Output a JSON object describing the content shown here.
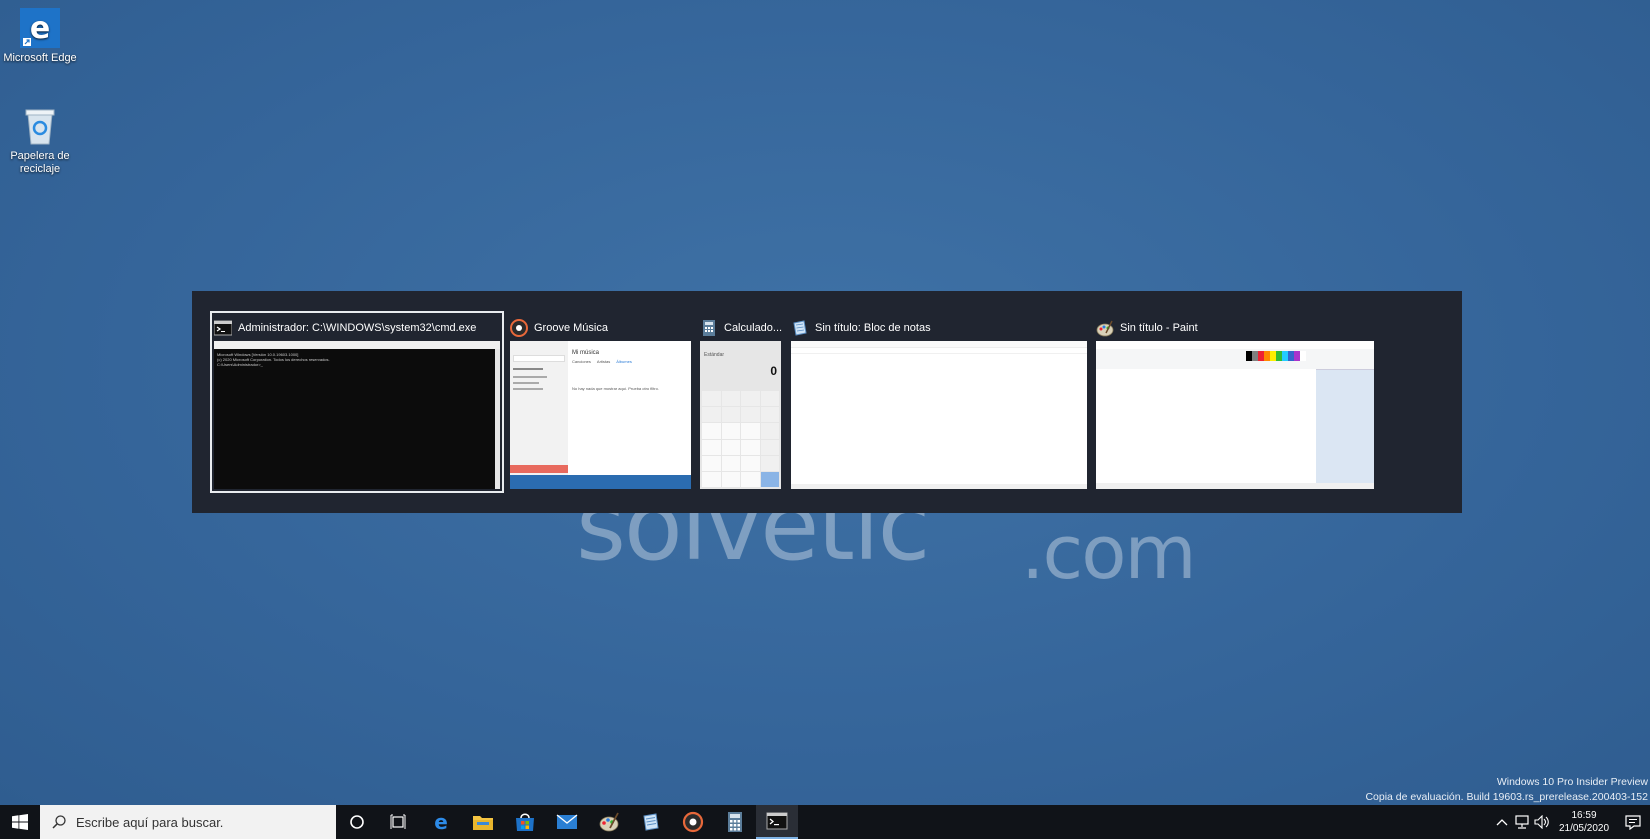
{
  "desktop": {
    "icons": [
      {
        "label": "Microsoft Edge",
        "icon": "edge-icon"
      },
      {
        "label": "Papelera de reciclaje",
        "icon": "recycle-bin-icon"
      }
    ],
    "watermark": {
      "brand": "solvetic",
      "suffix": ".com"
    },
    "os_watermark": {
      "line1": "Windows 10 Pro Insider Preview",
      "line2": "Copia de evaluación. Build 19603.rs_prerelease.200403-152"
    }
  },
  "switcher": {
    "windows": [
      {
        "title": "Administrador: C:\\WINDOWS\\system32\\cmd.exe",
        "icon": "cmd-icon",
        "selected": true,
        "preview_lines": [
          "Microsoft Windows [Versión 10.0.19603.1000]",
          "(c) 2020 Microsoft Corporation. Todos los derechos reservados.",
          "",
          "C:\\Users\\Administrador>_"
        ]
      },
      {
        "title": "Groove Música",
        "icon": "groove-icon",
        "selected": false,
        "preview_heading": "Mi música",
        "preview_tabs": [
          "Canciones",
          "Artistas",
          "Álbumes"
        ],
        "preview_body": "No hay nada que mostrar aquí. Prueba otro filtro."
      },
      {
        "title": "Calculado...",
        "icon": "calculator-icon",
        "selected": false,
        "preview_mode": "Estándar",
        "preview_display": "0"
      },
      {
        "title": "Sin título: Bloc de notas",
        "icon": "notepad-icon",
        "selected": false
      },
      {
        "title": "Sin título - Paint",
        "icon": "paint-icon",
        "selected": false
      }
    ]
  },
  "taskbar": {
    "search_placeholder": "Escribe aquí para buscar.",
    "pinned": [
      "cortana-icon",
      "task-view-icon",
      "edge-icon",
      "file-explorer-icon",
      "store-icon",
      "mail-icon",
      "paint-icon",
      "notepad-icon",
      "groove-icon",
      "calculator-icon",
      "cmd-icon"
    ],
    "clock_time": "16:59",
    "clock_date": "21/05/2020"
  }
}
